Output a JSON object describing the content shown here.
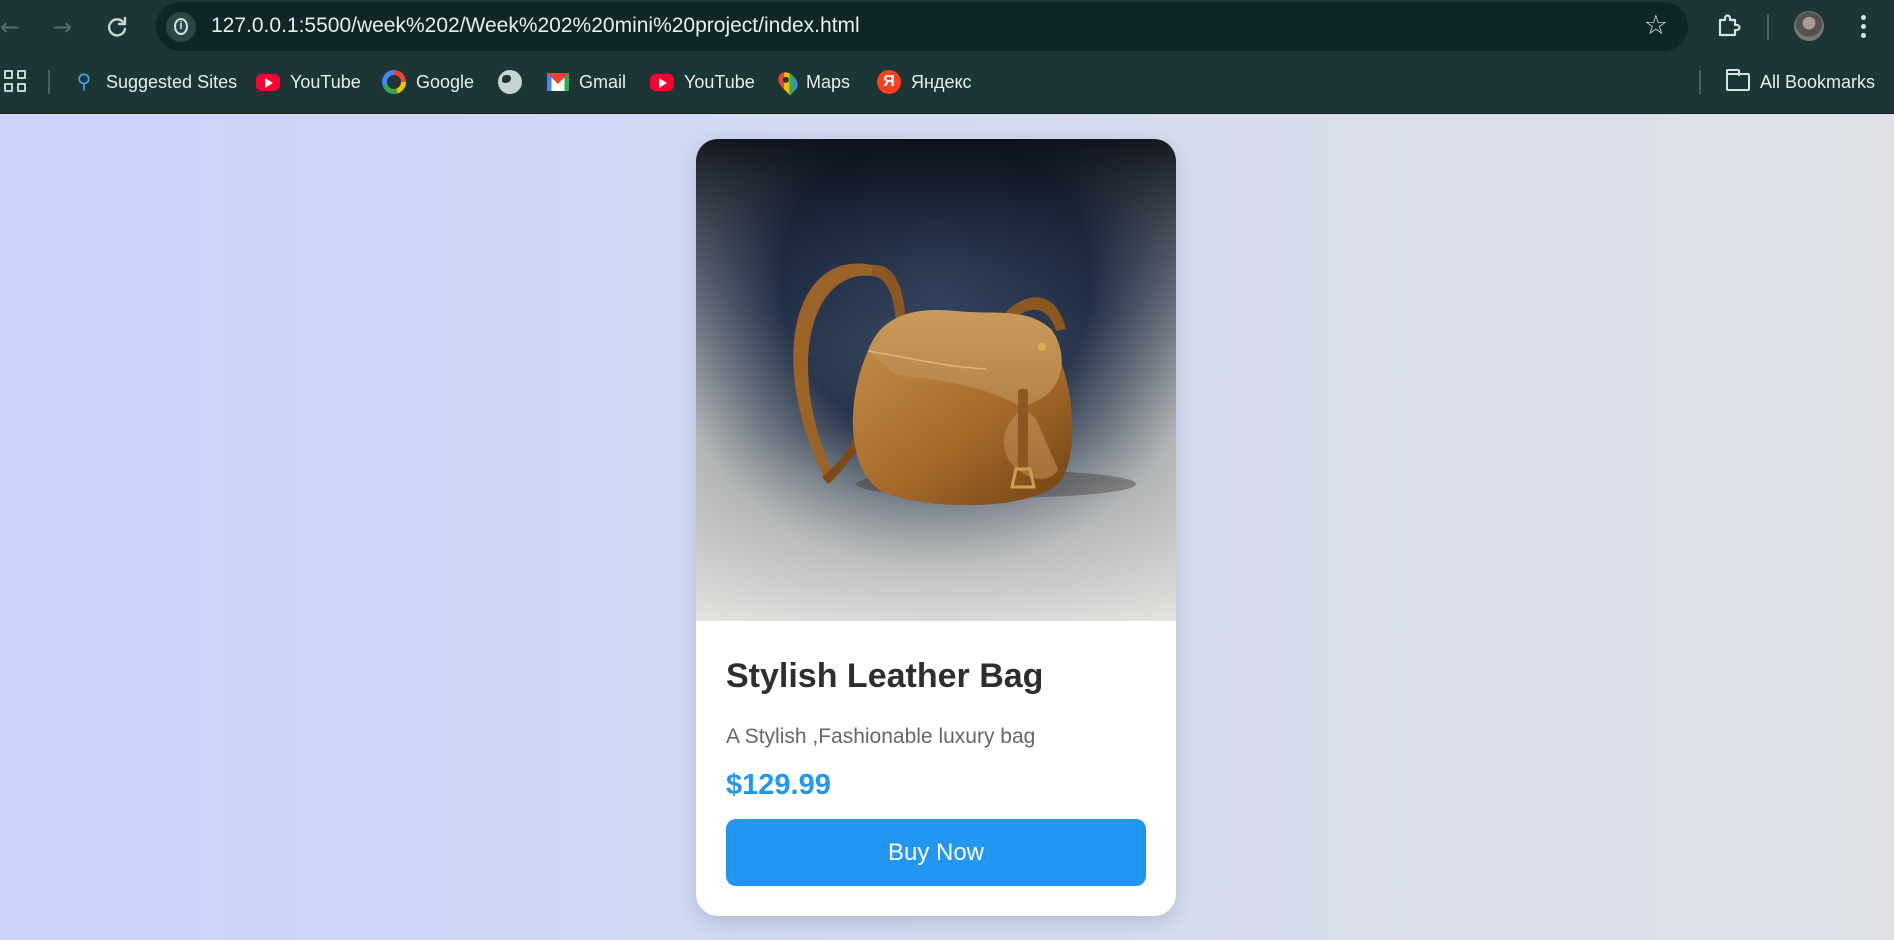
{
  "browser": {
    "url": "127.0.0.1:5500/week%202/Week%202%20mini%20project/index.html",
    "icons": {
      "back": "arrow-left-icon",
      "forward": "arrow-right-icon",
      "reload": "reload-icon",
      "site_info": "info-icon",
      "bookmark_star": "star-icon",
      "extensions": "puzzle-icon",
      "profile": "avatar",
      "menu": "more-vertical-icon"
    }
  },
  "bookmarks": {
    "items": [
      {
        "label": "Suggested Sites",
        "icon": "search-icon"
      },
      {
        "label": "YouTube",
        "icon": "youtube-icon"
      },
      {
        "label": "Google",
        "icon": "google-icon"
      },
      {
        "label": "",
        "icon": "globe-icon"
      },
      {
        "label": "Gmail",
        "icon": "gmail-icon"
      },
      {
        "label": "YouTube",
        "icon": "youtube-icon"
      },
      {
        "label": "Maps",
        "icon": "maps-pin-icon"
      },
      {
        "label": "Яндекс",
        "icon": "yandex-icon"
      }
    ],
    "all_bookmarks": {
      "label": "All Bookmarks",
      "icon": "folder-icon"
    }
  },
  "product": {
    "image": "leather-bag-photo",
    "title": "Stylish Leather Bag",
    "description": "A Stylish ,Fashionable luxury bag",
    "price": "$129.99",
    "button_label": "Buy Now"
  },
  "colors": {
    "accent": "#2196f3",
    "chrome": "#1c3535",
    "omnibox": "#0f2626",
    "page_background_left": "#c9d3fc",
    "page_background_right": "#dfe1e6"
  }
}
